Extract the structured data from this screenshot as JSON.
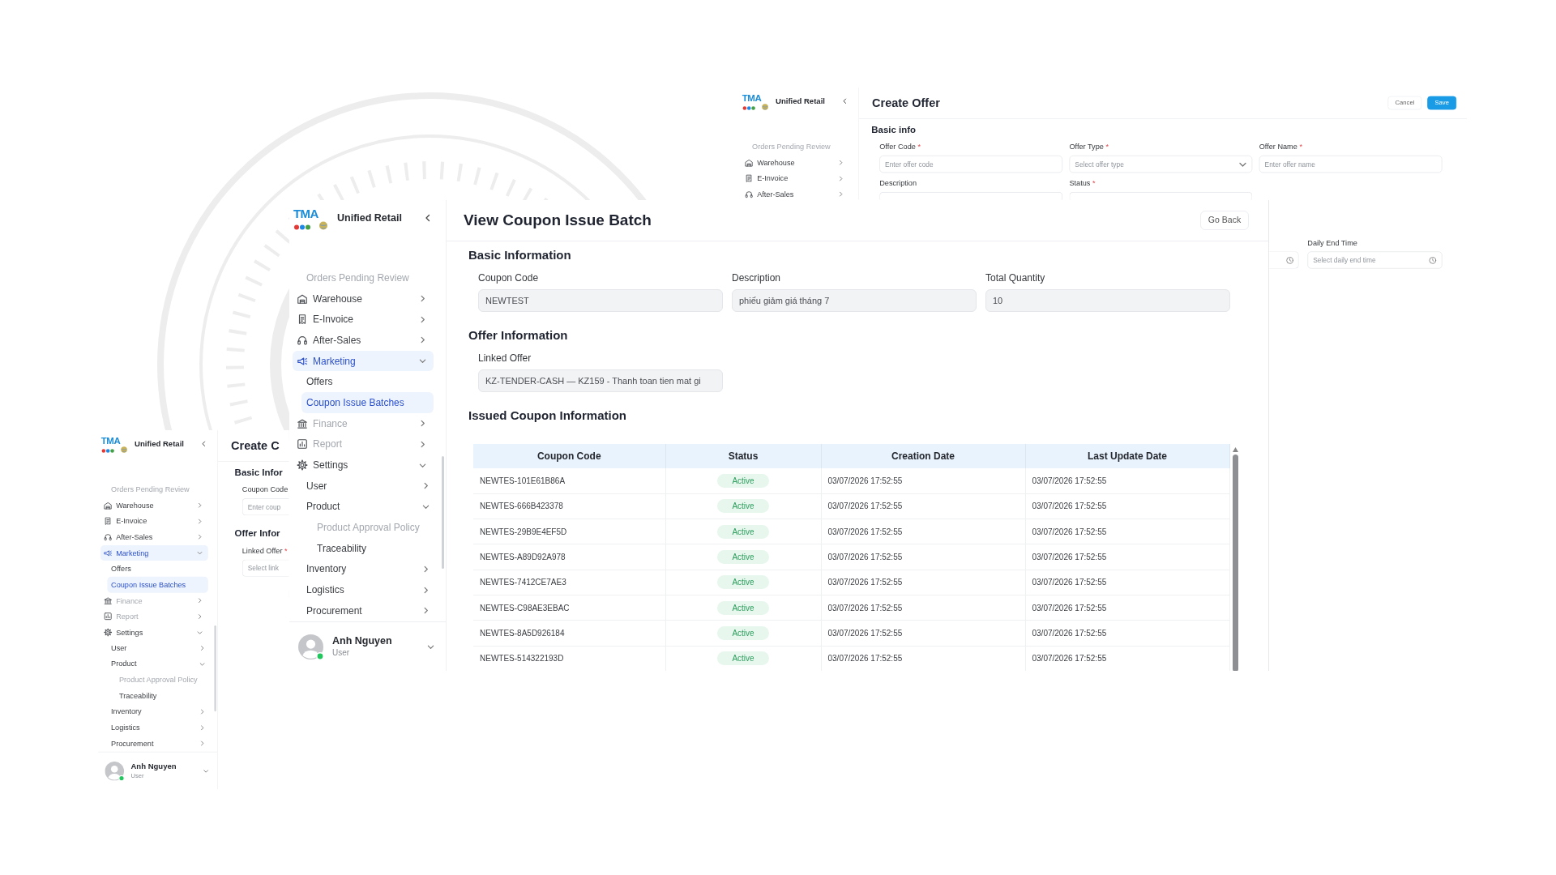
{
  "create_offer_window": {
    "sidebar": {
      "logo_text": "TMA",
      "app_name": "Unified Retail",
      "items": [
        {
          "label": "Orders Pending Review",
          "kind": "link",
          "selected": false,
          "disabled": true
        },
        {
          "label": "Warehouse",
          "kind": "group",
          "selected": false,
          "disabled": false,
          "expanded": false
        },
        {
          "label": "E-Invoice",
          "kind": "group",
          "selected": false,
          "disabled": false,
          "expanded": false
        },
        {
          "label": "After-Sales",
          "kind": "group",
          "selected": false,
          "disabled": false,
          "expanded": false
        }
      ]
    },
    "title": "Create Offer",
    "buttons": [
      {
        "label": "Cancel",
        "kind": "secondary"
      },
      {
        "label": "Save",
        "kind": "primary"
      }
    ],
    "sections": [
      {
        "title": "Basic info",
        "fields": [
          {
            "label": "Offer Code",
            "required_mark": "*",
            "kind": "text",
            "placeholder": "Enter offer code"
          },
          {
            "label": "Offer Type",
            "required_mark": "*",
            "kind": "select",
            "placeholder": "Select offer type"
          },
          {
            "label": "Offer Name",
            "required_mark": "*",
            "kind": "text",
            "placeholder": "Enter offer name"
          },
          {
            "label": "Description",
            "kind": "text"
          },
          {
            "label": "Status",
            "required_mark": "*",
            "kind": "select"
          }
        ]
      }
    ],
    "schedule_fields": [
      {
        "kind": "time"
      },
      {
        "kind": "time",
        "label": "Daily End Time",
        "placeholder": "Select daily end time"
      }
    ]
  },
  "coupon_batch_window": {
    "sidebar": {
      "logo_text": "TMA",
      "app_name": "Unified Retail",
      "items": [
        {
          "label": "Orders Pending Review",
          "kind": "link",
          "selected": false,
          "disabled": true
        },
        {
          "label": "Warehouse",
          "kind": "group",
          "selected": false,
          "disabled": false,
          "expanded": false
        },
        {
          "label": "E-Invoice",
          "kind": "group",
          "selected": false,
          "disabled": false,
          "expanded": false
        },
        {
          "label": "After-Sales",
          "kind": "group",
          "selected": false,
          "disabled": false,
          "expanded": false
        },
        {
          "label": "Marketing",
          "kind": "group",
          "selected": true,
          "disabled": false,
          "expanded": true,
          "children": [
            {
              "label": "Offers",
              "kind": "link",
              "selected": false,
              "disabled": false
            },
            {
              "label": "Coupon Issue Batches",
              "kind": "link",
              "selected": true,
              "disabled": false
            }
          ]
        },
        {
          "label": "Finance",
          "kind": "group",
          "selected": false,
          "disabled": true,
          "expanded": false
        },
        {
          "label": "Report",
          "kind": "group",
          "selected": false,
          "disabled": true,
          "expanded": false
        },
        {
          "label": "Settings",
          "kind": "group",
          "selected": false,
          "disabled": false,
          "expanded": true,
          "children": [
            {
              "label": "User",
              "kind": "folder",
              "selected": false,
              "disabled": false,
              "expanded": false
            },
            {
              "label": "Product",
              "kind": "folder",
              "selected": false,
              "disabled": false,
              "expanded": true,
              "children": [
                {
                  "label": "Product Approval Policy",
                  "kind": "link",
                  "selected": false,
                  "disabled": true
                },
                {
                  "label": "Traceability",
                  "kind": "link",
                  "selected": false,
                  "disabled": false
                }
              ]
            },
            {
              "label": "Inventory",
              "kind": "folder",
              "selected": false,
              "disabled": false,
              "expanded": false
            },
            {
              "label": "Logistics",
              "kind": "folder",
              "selected": false,
              "disabled": false,
              "expanded": false
            },
            {
              "label": "Procurement",
              "kind": "folder",
              "selected": false,
              "disabled": false,
              "expanded": false
            }
          ]
        }
      ],
      "user": {
        "name": "Anh Nguyen",
        "role": "User",
        "online": true
      }
    },
    "title": "View Coupon Issue Batch",
    "back_button": "Go Back",
    "sections": [
      {
        "title": "Basic Information",
        "fields": [
          {
            "label": "Coupon Code",
            "value": "NEWTEST"
          },
          {
            "label": "Description",
            "value": "phiếu giảm giá tháng 7"
          },
          {
            "label": "Total Quantity",
            "value": "10"
          }
        ]
      },
      {
        "title": "Offer Information",
        "fields": [
          {
            "label": "Linked Offer",
            "value": "KZ-TENDER-CASH — KZ159 - Thanh toan tien mat gi"
          }
        ]
      }
    ],
    "table": {
      "title": "Issued Coupon Information",
      "columns": [
        "Coupon Code",
        "Status",
        "Creation Date",
        "Last Update Date"
      ],
      "rows": [
        {
          "coupon_code": "NEWTES-101E61B86A",
          "status": "Active",
          "creation_date": "03/07/2026 17:52:55",
          "last_update_date": "03/07/2026 17:52:55"
        },
        {
          "coupon_code": "NEWTES-666B423378",
          "status": "Active",
          "creation_date": "03/07/2026 17:52:55",
          "last_update_date": "03/07/2026 17:52:55"
        },
        {
          "coupon_code": "NEWTES-29B9E4EF5D",
          "status": "Active",
          "creation_date": "03/07/2026 17:52:55",
          "last_update_date": "03/07/2026 17:52:55"
        },
        {
          "coupon_code": "NEWTES-A89D92A978",
          "status": "Active",
          "creation_date": "03/07/2026 17:52:55",
          "last_update_date": "03/07/2026 17:52:55"
        },
        {
          "coupon_code": "NEWTES-7412CE7AE3",
          "status": "Active",
          "creation_date": "03/07/2026 17:52:55",
          "last_update_date": "03/07/2026 17:52:55"
        },
        {
          "coupon_code": "NEWTES-C98AE3EBAC",
          "status": "Active",
          "creation_date": "03/07/2026 17:52:55",
          "last_update_date": "03/07/2026 17:52:55"
        },
        {
          "coupon_code": "NEWTES-8A5D926184",
          "status": "Active",
          "creation_date": "03/07/2026 17:52:55",
          "last_update_date": "03/07/2026 17:52:55"
        },
        {
          "coupon_code": "NEWTES-514322193D",
          "status": "Active",
          "creation_date": "03/07/2026 17:52:55",
          "last_update_date": "03/07/2026 17:52:55"
        }
      ]
    }
  },
  "create_coupon_window": {
    "sidebar": {
      "logo_text": "TMA",
      "app_name": "Unified Retail",
      "items": [
        {
          "label": "Orders Pending Review",
          "kind": "link",
          "selected": false,
          "disabled": true
        },
        {
          "label": "Warehouse",
          "kind": "group",
          "selected": false,
          "disabled": false,
          "expanded": false
        },
        {
          "label": "E-Invoice",
          "kind": "group",
          "selected": false,
          "disabled": false,
          "expanded": false
        },
        {
          "label": "After-Sales",
          "kind": "group",
          "selected": false,
          "disabled": false,
          "expanded": false
        },
        {
          "label": "Marketing",
          "kind": "group",
          "selected": true,
          "disabled": false,
          "expanded": true,
          "children": [
            {
              "label": "Offers",
              "kind": "link",
              "selected": false,
              "disabled": false
            },
            {
              "label": "Coupon Issue Batches",
              "kind": "link",
              "selected": true,
              "disabled": false
            }
          ]
        },
        {
          "label": "Finance",
          "kind": "group",
          "selected": false,
          "disabled": true,
          "expanded": false
        },
        {
          "label": "Report",
          "kind": "group",
          "selected": false,
          "disabled": true,
          "expanded": false
        },
        {
          "label": "Settings",
          "kind": "group",
          "selected": false,
          "disabled": false,
          "expanded": true,
          "children": [
            {
              "label": "User",
              "kind": "folder",
              "selected": false,
              "disabled": false,
              "expanded": false
            },
            {
              "label": "Product",
              "kind": "folder",
              "selected": false,
              "disabled": false,
              "expanded": true,
              "children": [
                {
                  "label": "Product Approval Policy",
                  "kind": "link",
                  "selected": false,
                  "disabled": true
                },
                {
                  "label": "Traceability",
                  "kind": "link",
                  "selected": false,
                  "disabled": false
                }
              ]
            },
            {
              "label": "Inventory",
              "kind": "folder",
              "selected": false,
              "disabled": false,
              "expanded": false
            },
            {
              "label": "Logistics",
              "kind": "folder",
              "selected": false,
              "disabled": false,
              "expanded": false
            },
            {
              "label": "Procurement",
              "kind": "folder",
              "selected": false,
              "disabled": false,
              "expanded": false
            }
          ]
        }
      ],
      "user": {
        "name": "Anh Nguyen",
        "role": "User",
        "online": true
      }
    },
    "title": "Create C",
    "sections": [
      {
        "title": "Basic Infor",
        "fields": [
          {
            "label": "Coupon Code",
            "placeholder": "Enter coup"
          }
        ]
      },
      {
        "title": "Offer Infor",
        "fields": [
          {
            "label": "Linked Offer",
            "required_mark": "*",
            "placeholder": "Select link"
          }
        ]
      }
    ]
  }
}
